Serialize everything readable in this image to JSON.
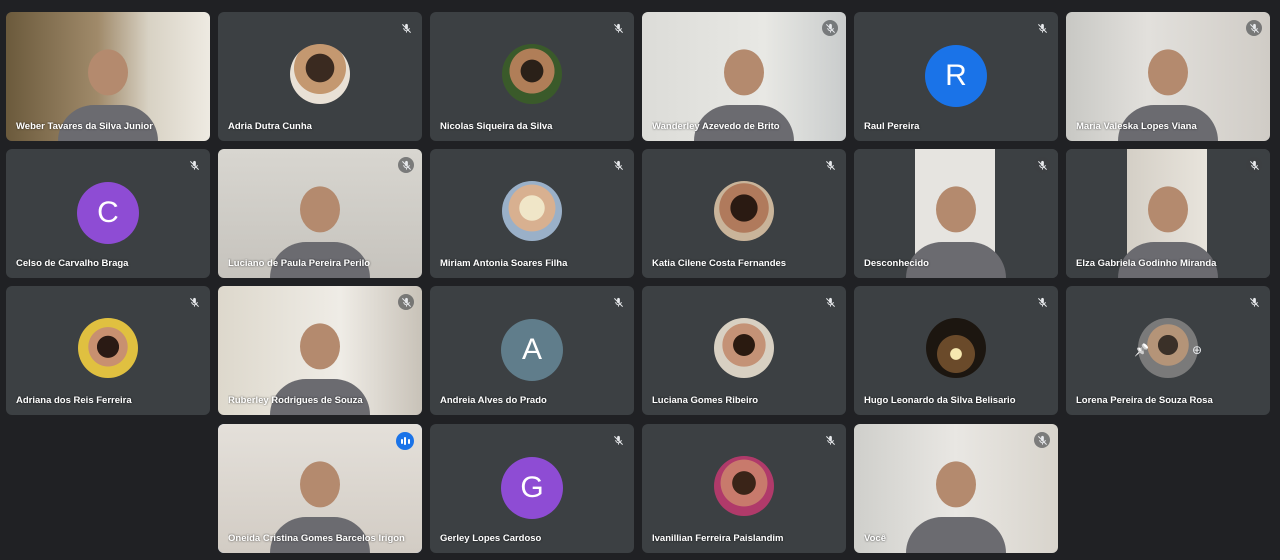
{
  "meeting": {
    "participants": [
      {
        "name": "Weber Tavares da Silva Junior",
        "kind": "video",
        "muted": false
      },
      {
        "name": "Adria Dutra Cunha",
        "kind": "photo",
        "muted": true
      },
      {
        "name": "Nicolas Siqueira da Silva",
        "kind": "photo",
        "muted": true
      },
      {
        "name": "Wanderley Azevedo de Brito",
        "kind": "video",
        "muted": true
      },
      {
        "name": "Raul Pereira",
        "kind": "letter",
        "letter": "R",
        "color": "#1a73e8",
        "muted": true
      },
      {
        "name": "Maria Valeska Lopes Viana",
        "kind": "video",
        "muted": true
      },
      {
        "name": "Celso de Carvalho Braga",
        "kind": "letter",
        "letter": "C",
        "color": "#8e4cd4",
        "muted": true
      },
      {
        "name": "Luciano de Paula Pereira Perilo",
        "kind": "video",
        "muted": true
      },
      {
        "name": "Miriam Antonia Soares Filha",
        "kind": "photo",
        "muted": true
      },
      {
        "name": "Katia Cilene Costa Fernandes",
        "kind": "photo",
        "muted": true
      },
      {
        "name": "Desconhecido",
        "kind": "video",
        "muted": true
      },
      {
        "name": "Elza Gabriela Godinho Miranda",
        "kind": "video",
        "muted": true
      },
      {
        "name": "Adriana dos Reis Ferreira",
        "kind": "photo",
        "muted": true
      },
      {
        "name": "Ruberley Rodrigues de Souza",
        "kind": "video",
        "muted": true
      },
      {
        "name": "Andreia Alves do Prado",
        "kind": "letter",
        "letter": "A",
        "color": "#607d8b",
        "muted": true
      },
      {
        "name": "Luciana Gomes Ribeiro",
        "kind": "photo",
        "muted": true
      },
      {
        "name": "Hugo Leonardo da Silva Belisario",
        "kind": "photo",
        "muted": true
      },
      {
        "name": "Lorena Pereira de Souza Rosa",
        "kind": "photo",
        "muted": true,
        "hover": true
      },
      {
        "name": "Oneida Cristina Gomes Barcelos Irigon",
        "kind": "video",
        "muted": false,
        "speaking": true
      },
      {
        "name": "Gerley Lopes Cardoso",
        "kind": "letter",
        "letter": "G",
        "color": "#8e4cd4",
        "muted": true
      },
      {
        "name": "Ivanillian Ferreira Paislandim",
        "kind": "photo",
        "muted": true
      },
      {
        "name": "Você",
        "kind": "video",
        "muted": true
      }
    ],
    "icons": {
      "muted": "mic-off-icon",
      "speaking": "audio-level-icon",
      "pin": "pin-icon",
      "more": "more-options-icon"
    },
    "colors": {
      "background": "#202124",
      "tile": "#3c4043",
      "active_border": "#8ab4f8",
      "speaking_badge": "#1a73e8"
    }
  }
}
